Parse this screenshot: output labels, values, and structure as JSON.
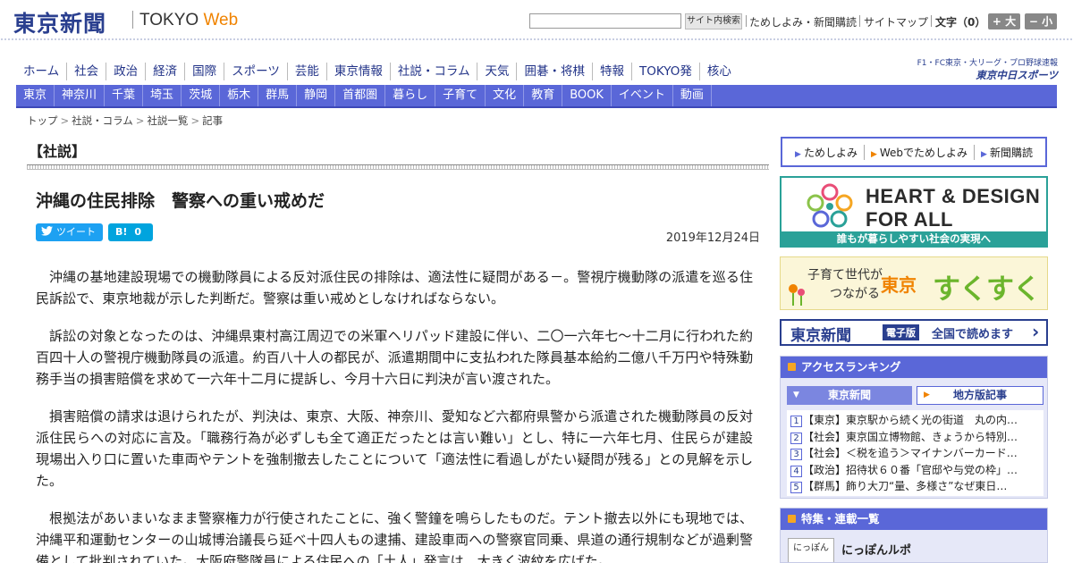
{
  "header": {
    "logo_kanji": "東京新聞",
    "logo_tokyo": "TOKYO",
    "logo_web": "Web",
    "search_placeholder": "",
    "search_button": "サイト内検索",
    "links": [
      "ためしよみ・新聞購読",
      "サイトマップ"
    ],
    "font_size_label": "文字（0）",
    "font_larger": "+ 大",
    "font_smaller": "− 小"
  },
  "main_nav": [
    "ホーム",
    "社会",
    "政治",
    "経済",
    "国際",
    "スポーツ",
    "芸能",
    "東京情報",
    "社説・コラム",
    "天気",
    "囲碁・将棋",
    "特報",
    "TOKYO発",
    "核心"
  ],
  "chunichi_sports": {
    "top_text": "F1・FC東京・大リーグ・プロ野球速報",
    "logo_text": "東京中日スポーツ"
  },
  "sub_nav": [
    "東京",
    "神奈川",
    "千葉",
    "埼玉",
    "茨城",
    "栃木",
    "群馬",
    "静岡",
    "首都圏",
    "暮らし",
    "子育て",
    "文化",
    "教育",
    "BOOK",
    "イベント",
    "動画"
  ],
  "breadcrumb": [
    "トップ",
    "社説・コラム",
    "社説一覧",
    "記事"
  ],
  "article": {
    "section": "【社説】",
    "headline": "沖縄の住民排除　警察への重い戒めだ",
    "tweet_label": "ツイート",
    "hatena_label": "B!",
    "hatena_count": "0",
    "date": "2019年12月24日",
    "paragraphs": [
      "沖縄の基地建設現場での機動隊員による反対派住民の排除は、適法性に疑問がある－。警視庁機動隊の派遣を巡る住民訴訟で、東京地裁が示した判断だ。警察は重い戒めとしなければならない。",
      "訴訟の対象となったのは、沖縄県東村高江周辺での米軍ヘリパッド建設に伴い、二〇一六年七～十二月に行われた約百四十人の警視庁機動隊員の派遣。約百八十人の都民が、派遣期間中に支払われた隊員基本給約二億八千万円や特殊勤務手当の損害賠償を求めて一六年十二月に提訴し、今月十六日に判決が言い渡された。",
      "損害賠償の請求は退けられたが、判決は、東京、大阪、神奈川、愛知など六都府県警から派遣された機動隊員の反対派住民らへの対応に言及。「職務行為が必ずしも全て適正だったとは言い難い」とし、特に一六年七月、住民らが建設現場出入り口に置いた車両やテントを強制撤去したことについて「適法性に看過しがたい疑問が残る」との見解を示した。",
      "根拠法があいまいなまま警察権力が行使されたことに、強く警鐘を鳴らしたものだ。テント撤去以外にも現地では、沖縄平和運動センターの山城博治議長ら延べ十四人もの逮捕、建設車両への警察官同乗、県道の通行規制などが過剰警備として批判されていた。大阪府警隊員による住民への「土人」発言は、大きく波紋を広げた。"
    ]
  },
  "sidebar": {
    "promo_links": [
      "ためしよみ",
      "Webでためしよみ",
      "新聞購読"
    ],
    "heart_design": {
      "line1": "HEART & DESIGN",
      "line2": "FOR ALL",
      "caption": "誰もが暮らしやすい社会の実現へ"
    },
    "sukusuku": {
      "line1": "子育て世代が",
      "line2": "つながる",
      "tokyo": "東京",
      "suku": "すくすく"
    },
    "denshi": {
      "name": "東京新聞",
      "badge": "電子版",
      "text": "全国で読めます"
    },
    "ranking": {
      "title": "アクセスランキング",
      "tab_tokyo": "東京新聞",
      "tab_local": "地方版記事",
      "items": [
        {
          "num": "1",
          "text": "【東京】東京駅から続く光の街道　丸の内…"
        },
        {
          "num": "2",
          "text": "【社会】東京国立博物館、きょうから特別…"
        },
        {
          "num": "3",
          "text": "【社会】＜税を追う＞マイナンバーカード…"
        },
        {
          "num": "4",
          "text": "【政治】招待状６０番「官邸や与党の枠」…"
        },
        {
          "num": "5",
          "text": "【群馬】飾り大刀“量、多様さ”なぜ東日…"
        }
      ]
    },
    "features": {
      "title": "特集・連載一覧",
      "thumb_label": "にっぽん",
      "item_title": "にっぽんルポ"
    }
  },
  "colors": {
    "brand_blue": "#2a3f8f",
    "nav_purple": "#5a67d8",
    "accent_orange": "#f08300",
    "teal": "#2aa198"
  }
}
